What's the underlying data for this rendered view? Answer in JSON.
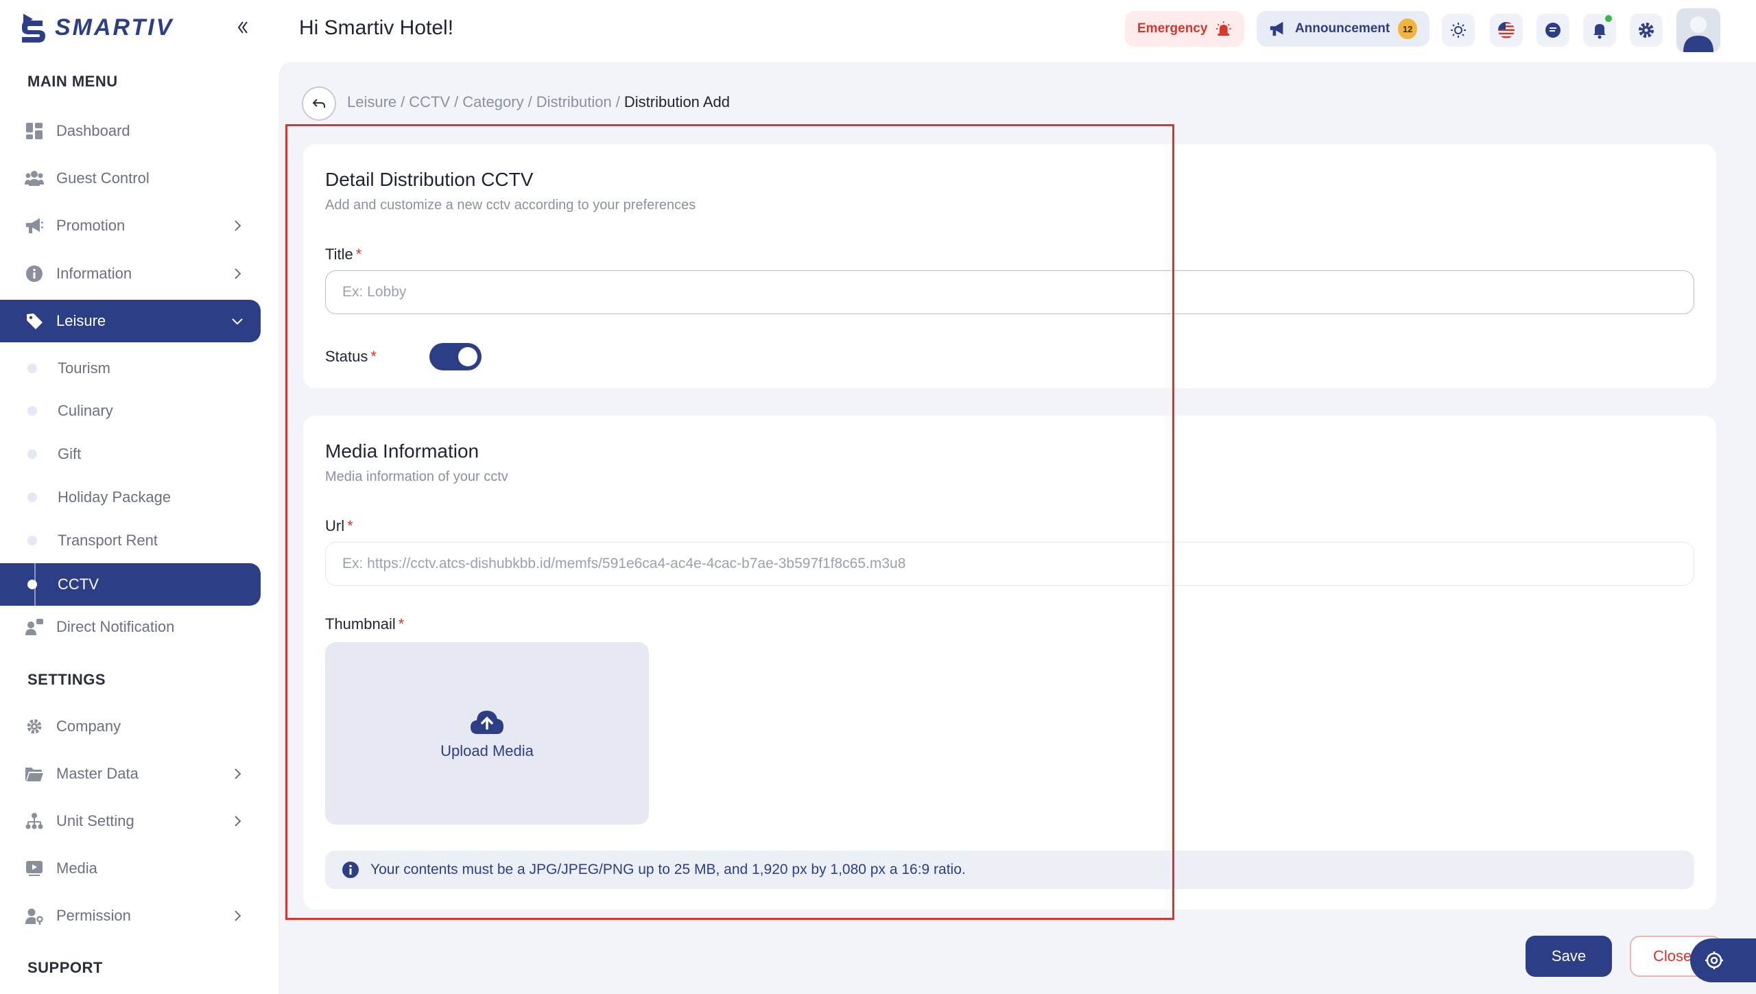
{
  "brand": {
    "name": "SMARTIV"
  },
  "header": {
    "greeting": "Hi Smartiv Hotel!",
    "emergency_label": "Emergency",
    "announcement_label": "Announcement",
    "announcement_count": "12"
  },
  "sidebar": {
    "main_menu_label": "MAIN MENU",
    "items": {
      "dashboard": "Dashboard",
      "guest_control": "Guest Control",
      "promotion": "Promotion",
      "information": "Information",
      "leisure": "Leisure",
      "direct_notification": "Direct Notification"
    },
    "leisure_sub": {
      "tourism": "Tourism",
      "culinary": "Culinary",
      "gift": "Gift",
      "holiday_package": "Holiday Package",
      "transport_rent": "Transport Rent",
      "cctv": "CCTV"
    },
    "settings_label": "SETTINGS",
    "settings_items": {
      "company": "Company",
      "master_data": "Master Data",
      "unit_setting": "Unit Setting",
      "media": "Media",
      "permission": "Permission"
    },
    "support_label": "SUPPORT"
  },
  "breadcrumb": {
    "leisure": "Leisure",
    "cctv": "CCTV",
    "category": "Category",
    "distribution": "Distribution",
    "current": "Distribution Add",
    "sep": "/"
  },
  "detail_card": {
    "title": "Detail Distribution CCTV",
    "subtitle": "Add and customize a new cctv according to your preferences",
    "title_label": "Title",
    "title_placeholder": "Ex: Lobby",
    "status_label": "Status",
    "required_mark": "*"
  },
  "media_card": {
    "title": "Media Information",
    "subtitle": "Media information of your cctv",
    "url_label": "Url",
    "url_placeholder": "Ex: https://cctv.atcs-dishubkbb.id/memfs/591e6ca4-ac4e-4cac-b7ae-3b597f1f8c65.m3u8",
    "thumbnail_label": "Thumbnail",
    "upload_label": "Upload Media",
    "info_text": "Your contents must be a JPG/JPEG/PNG up to 25 MB, and 1,920 px by 1,080 px a 16:9 ratio."
  },
  "actions": {
    "save": "Save",
    "close": "Close"
  },
  "colors": {
    "primary": "#2c3e86",
    "danger": "#d8352a",
    "badge": "#f4b43b",
    "background": "#f2f4fa"
  }
}
